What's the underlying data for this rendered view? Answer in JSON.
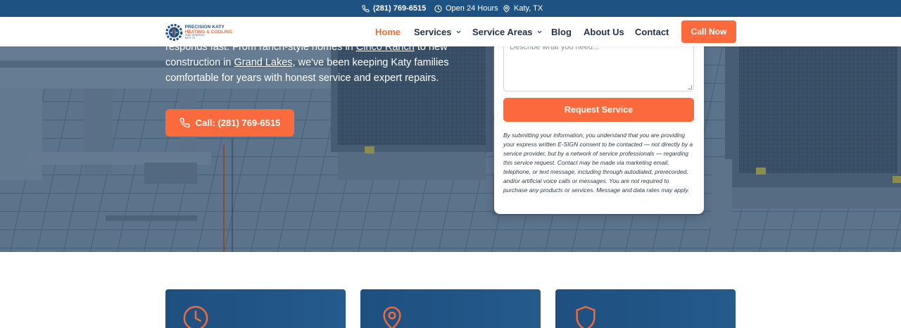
{
  "topbar": {
    "phone": "(281) 769-6515",
    "hours": "Open 24 Hours",
    "location": "Katy, TX"
  },
  "logo": {
    "line1": "PRECISION KATY",
    "line2": "HEATING & COOLING",
    "line3": "HVAC SERVICES",
    "line4": "KATY, TX"
  },
  "nav": {
    "items": [
      {
        "label": "Home",
        "active": true
      },
      {
        "label": "Services",
        "has_dropdown": true
      },
      {
        "label": "Service Areas",
        "has_dropdown": true
      },
      {
        "label": "Blog"
      },
      {
        "label": "About Us"
      },
      {
        "label": "Contact"
      }
    ],
    "cta": "Call Now"
  },
  "hero": {
    "text_part1": "responds fast. From ranch-style homes in ",
    "link1": "Cinco Ranch",
    "text_part2": " to new construction in ",
    "link2": "Grand Lakes",
    "text_part3": ", we've been keeping Katy families comfortable for years with honest service and expert repairs.",
    "cta_label": "Call: (281) 769-6515"
  },
  "form": {
    "textarea_placeholder": "Describe what you need...",
    "submit_label": "Request Service",
    "disclaimer": "By submitting your information, you understand that you are providing your express written E-SIGN consent to be contacted — not directly by a service provider, but by a network of service professionals — regarding this service request. Contact may be made via marketing email, telephone, or text message, including through autodialed, prerecorded, and/or artificial voice calls or messages. You are not required to purchase any products or services. Message and data rates may apply."
  },
  "features": [
    {
      "icon": "clock-icon"
    },
    {
      "icon": "map-pin-icon"
    },
    {
      "icon": "shield-icon"
    }
  ],
  "colors": {
    "brand_blue": "#1e5282",
    "accent_orange": "#fb6a3d",
    "nav_text": "#24324a"
  }
}
